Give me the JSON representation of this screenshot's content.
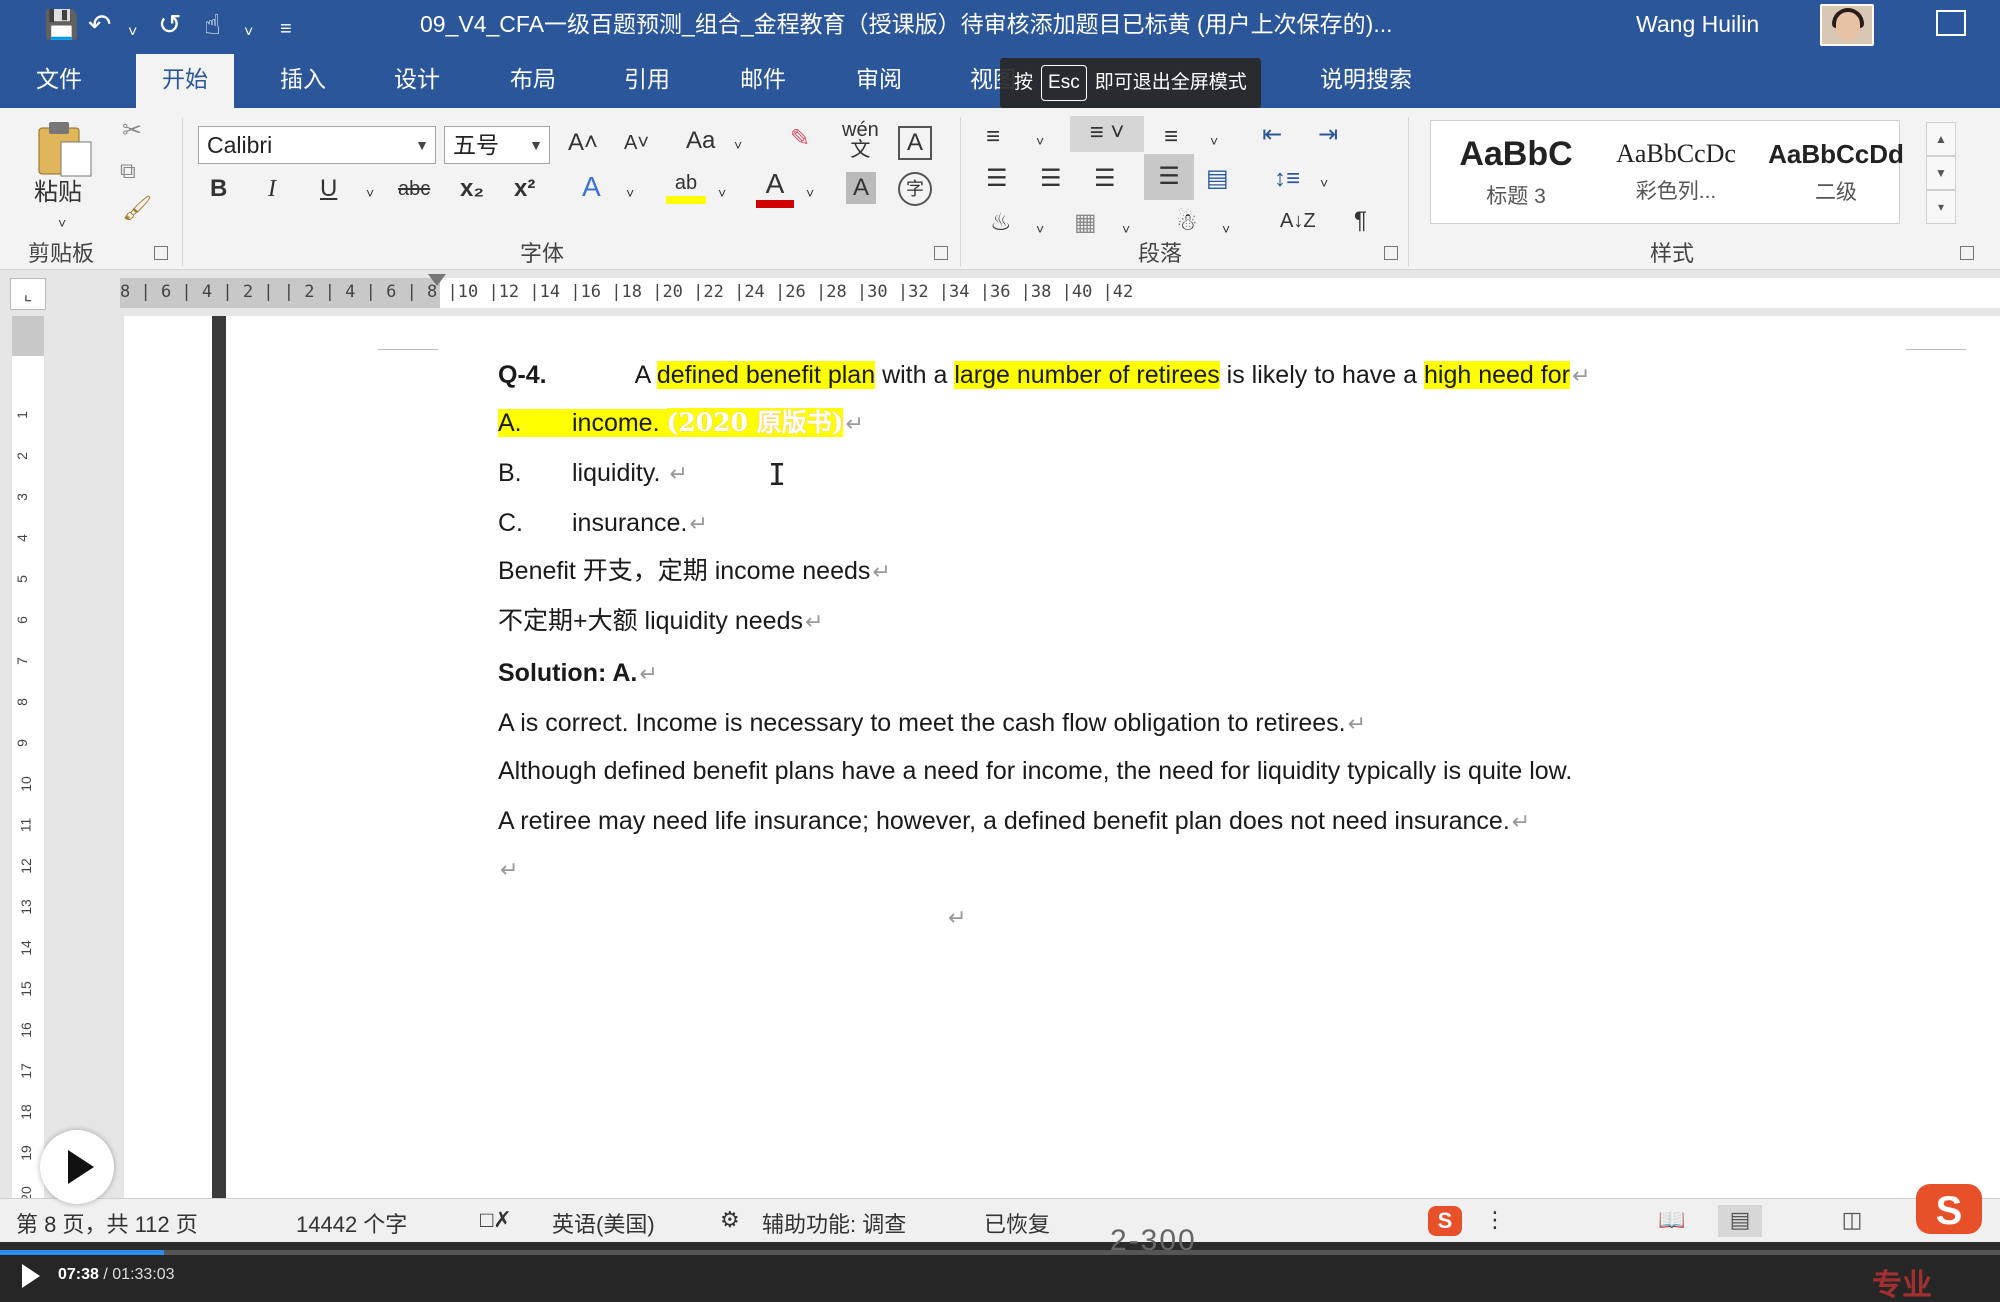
{
  "titlebar": {
    "qat": [
      "save-icon",
      "undo-icon",
      "redo-icon",
      "touch-mode-icon",
      "customize-icon"
    ],
    "doc_title": "09_V4_CFA一级百题预测_组合_金程教育（授课版）待审核添加题目已标黄 (用户上次保存的)...",
    "user_name": "Wang Huilin"
  },
  "tabs": [
    "文件",
    "开始",
    "插入",
    "设计",
    "布局",
    "引用",
    "邮件",
    "审阅",
    "视图",
    "说明搜索"
  ],
  "active_tab": "开始",
  "esc_tip": {
    "prefix": "按",
    "key": "Esc",
    "suffix": "即可退出全屏模式"
  },
  "ribbon": {
    "clipboard": {
      "paste_label": "粘贴",
      "group_label": "剪贴板"
    },
    "font": {
      "font_name": "Calibri",
      "font_size": "五号",
      "grow": "A˄",
      "shrink": "A˅",
      "case": "Aa",
      "phonetic": "wén",
      "bold": "B",
      "italic": "I",
      "underline": "U",
      "strike": "abc",
      "subscript": "x₂",
      "superscript": "x²",
      "group_label": "字体",
      "highlight_color": "#ffff00",
      "font_color": "#d00000"
    },
    "paragraph": {
      "group_label": "段落"
    },
    "styles": {
      "items": [
        {
          "preview": "AaBbC",
          "name": "标题 3"
        },
        {
          "preview": "AaBbCcDc",
          "name": "彩色列..."
        },
        {
          "preview": "AaBbCcDd",
          "name": "二级"
        }
      ],
      "group_label": "样式"
    }
  },
  "ruler": {
    "numbers": "8 | 6 | 4 | 2 |   | 2 | 4 | 6 | 8 |10 |12 |14 |16 |18 |20 |22 |24 |26 |28 |30 |32 |34 |36 |38 |40 |42"
  },
  "document": {
    "question_label": "Q-4.",
    "question_parts": [
      {
        "text": "A ",
        "hl": false
      },
      {
        "text": "defined benefit plan",
        "hl": true
      },
      {
        "text": " with a ",
        "hl": false
      },
      {
        "text": "large number of retirees",
        "hl": true
      },
      {
        "text": " is likely to have a ",
        "hl": false
      },
      {
        "text": "high need for",
        "hl": true
      }
    ],
    "options": [
      {
        "letter": "A.",
        "text": "income.",
        "stamp": "(2020 原版书)"
      },
      {
        "letter": "B.",
        "text": "liquidity."
      },
      {
        "letter": "C.",
        "text": "insurance."
      }
    ],
    "note1": "Benefit 开支，定期 income needs",
    "note2": "不定期+大额  liquidity needs",
    "solution_label": "Solution: A.",
    "explanations": [
      "A is correct. Income is necessary to meet the cash flow obligation to retirees.",
      "Although defined benefit plans have a need for income, the need for liquidity typically is quite low.",
      "A retiree may need life insurance; however, a defined benefit plan does not need insurance."
    ],
    "para_mark": "↵"
  },
  "statusbar": {
    "page_info": "第 8 页，共 112 页",
    "word_count": "14442 个字",
    "language": "英语(美国)",
    "accessibility": "辅助功能: 调查",
    "recovered": "已恢复",
    "page_stamp": "2-300"
  },
  "player": {
    "current_time": "07:38",
    "total_time": "01:33:03",
    "progress_fraction": 0.082,
    "watermark": "专业"
  }
}
